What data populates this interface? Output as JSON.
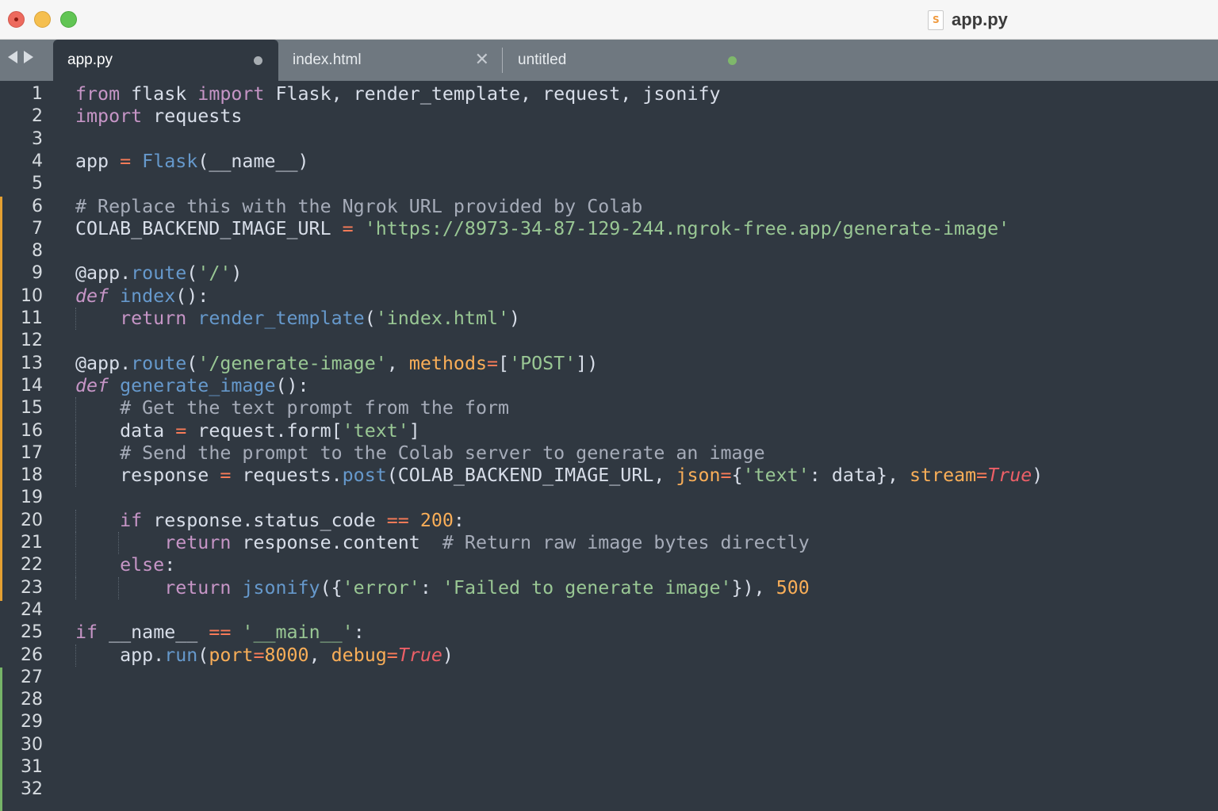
{
  "window": {
    "title": "app.py",
    "file_icon": "sublime-file-icon"
  },
  "tabs": [
    {
      "label": "app.py",
      "active": true,
      "indicator": "dirty-dot"
    },
    {
      "label": "index.html",
      "active": false,
      "indicator": "close-x"
    },
    {
      "label": "untitled",
      "active": false,
      "indicator": "dirty-dot-green"
    }
  ],
  "tab_close_glyph": "✕",
  "colors": {
    "editor_bg": "#303841",
    "tabbar_bg": "#6f7880",
    "keyword": "#c695c6",
    "function": "#6699cc",
    "string": "#99c794",
    "comment": "#a6acb9",
    "operator": "#f97b58",
    "number": "#f9ae58",
    "constant": "#ec5f67",
    "modified_marker": "#e4a032",
    "added_marker": "#76b468"
  },
  "line_numbers": [
    "1",
    "2",
    "3",
    "4",
    "5",
    "6",
    "7",
    "8",
    "9",
    "10",
    "11",
    "12",
    "13",
    "14",
    "15",
    "16",
    "17",
    "18",
    "19",
    "20",
    "21",
    "22",
    "23",
    "24",
    "25",
    "26",
    "27",
    "28",
    "29",
    "30",
    "31",
    "32"
  ],
  "code_lines": [
    [
      [
        "from",
        "t-keyword"
      ],
      [
        " flask ",
        "t-plain"
      ],
      [
        "import",
        "t-keyword"
      ],
      [
        " Flask, render_template, request, jsonify",
        "t-plain"
      ]
    ],
    [
      [
        "import",
        "t-keyword"
      ],
      [
        " requests",
        "t-plain"
      ]
    ],
    [],
    [
      [
        "app ",
        "t-plain"
      ],
      [
        "=",
        "t-op"
      ],
      [
        " ",
        "t-plain"
      ],
      [
        "Flask",
        "t-func"
      ],
      [
        "(__name__)",
        "t-plain"
      ]
    ],
    [],
    [
      [
        "# Replace this with the Ngrok URL provided by Colab",
        "t-comment"
      ]
    ],
    [
      [
        "COLAB_BACKEND_IMAGE_URL ",
        "t-plain"
      ],
      [
        "=",
        "t-op"
      ],
      [
        " ",
        "t-plain"
      ],
      [
        "'https://8973-34-87-129-244.ngrok-free.app/generate-image'",
        "t-string"
      ]
    ],
    [],
    [
      [
        "@app.",
        "t-plain"
      ],
      [
        "route",
        "t-func"
      ],
      [
        "(",
        "t-plain"
      ],
      [
        "'/'",
        "t-string"
      ],
      [
        ")",
        "t-plain"
      ]
    ],
    [
      [
        "def",
        "t-keyword-italic"
      ],
      [
        " ",
        "t-plain"
      ],
      [
        "index",
        "t-func"
      ],
      [
        "():",
        "t-plain"
      ]
    ],
    [
      [
        "    ",
        "t-plain"
      ],
      [
        "return",
        "t-keyword"
      ],
      [
        " ",
        "t-plain"
      ],
      [
        "render_template",
        "t-func"
      ],
      [
        "(",
        "t-plain"
      ],
      [
        "'index.html'",
        "t-string"
      ],
      [
        ")",
        "t-plain"
      ]
    ],
    [],
    [
      [
        "@app.",
        "t-plain"
      ],
      [
        "route",
        "t-func"
      ],
      [
        "(",
        "t-plain"
      ],
      [
        "'/generate-image'",
        "t-string"
      ],
      [
        ", ",
        "t-plain"
      ],
      [
        "methods",
        "t-param"
      ],
      [
        "=",
        "t-op"
      ],
      [
        "[",
        "t-plain"
      ],
      [
        "'POST'",
        "t-string"
      ],
      [
        "])",
        "t-plain"
      ]
    ],
    [
      [
        "def",
        "t-keyword-italic"
      ],
      [
        " ",
        "t-plain"
      ],
      [
        "generate_image",
        "t-func"
      ],
      [
        "():",
        "t-plain"
      ]
    ],
    [
      [
        "    ",
        "t-plain"
      ],
      [
        "# Get the text prompt from the form",
        "t-comment"
      ]
    ],
    [
      [
        "    data ",
        "t-plain"
      ],
      [
        "=",
        "t-op"
      ],
      [
        " request.form[",
        "t-plain"
      ],
      [
        "'text'",
        "t-string"
      ],
      [
        "]",
        "t-plain"
      ]
    ],
    [
      [
        "    ",
        "t-plain"
      ],
      [
        "# Send the prompt to the Colab server to generate an image",
        "t-comment"
      ]
    ],
    [
      [
        "    response ",
        "t-plain"
      ],
      [
        "=",
        "t-op"
      ],
      [
        " requests.",
        "t-plain"
      ],
      [
        "post",
        "t-func"
      ],
      [
        "(COLAB_BACKEND_IMAGE_URL, ",
        "t-plain"
      ],
      [
        "json",
        "t-param"
      ],
      [
        "=",
        "t-op"
      ],
      [
        "{",
        "t-plain"
      ],
      [
        "'text'",
        "t-string"
      ],
      [
        ": data}, ",
        "t-plain"
      ],
      [
        "stream",
        "t-param"
      ],
      [
        "=",
        "t-op"
      ],
      [
        "True",
        "t-const"
      ],
      [
        ")",
        "t-plain"
      ]
    ],
    [],
    [
      [
        "    ",
        "t-plain"
      ],
      [
        "if",
        "t-keyword"
      ],
      [
        " response.status_code ",
        "t-plain"
      ],
      [
        "==",
        "t-op"
      ],
      [
        " ",
        "t-plain"
      ],
      [
        "200",
        "t-number"
      ],
      [
        ":",
        "t-plain"
      ]
    ],
    [
      [
        "        ",
        "t-plain"
      ],
      [
        "return",
        "t-keyword"
      ],
      [
        " response.content  ",
        "t-plain"
      ],
      [
        "# Return raw image bytes directly",
        "t-comment"
      ]
    ],
    [
      [
        "    ",
        "t-plain"
      ],
      [
        "else",
        "t-keyword"
      ],
      [
        ":",
        "t-plain"
      ]
    ],
    [
      [
        "        ",
        "t-plain"
      ],
      [
        "return",
        "t-keyword"
      ],
      [
        " ",
        "t-plain"
      ],
      [
        "jsonify",
        "t-func"
      ],
      [
        "({",
        "t-plain"
      ],
      [
        "'error'",
        "t-string"
      ],
      [
        ": ",
        "t-plain"
      ],
      [
        "'Failed to generate image'",
        "t-string"
      ],
      [
        "}), ",
        "t-plain"
      ],
      [
        "500",
        "t-number"
      ]
    ],
    [],
    [
      [
        "if",
        "t-keyword"
      ],
      [
        " __name__ ",
        "t-plain"
      ],
      [
        "==",
        "t-op"
      ],
      [
        " ",
        "t-plain"
      ],
      [
        "'__main__'",
        "t-string"
      ],
      [
        ":",
        "t-plain"
      ]
    ],
    [
      [
        "    app.",
        "t-plain"
      ],
      [
        "run",
        "t-func"
      ],
      [
        "(",
        "t-plain"
      ],
      [
        "port",
        "t-param"
      ],
      [
        "=",
        "t-op"
      ],
      [
        "8000",
        "t-number"
      ],
      [
        ", ",
        "t-plain"
      ],
      [
        "debug",
        "t-param"
      ],
      [
        "=",
        "t-op"
      ],
      [
        "True",
        "t-const"
      ],
      [
        ")",
        "t-plain"
      ]
    ],
    [],
    [],
    [],
    [],
    [],
    []
  ]
}
